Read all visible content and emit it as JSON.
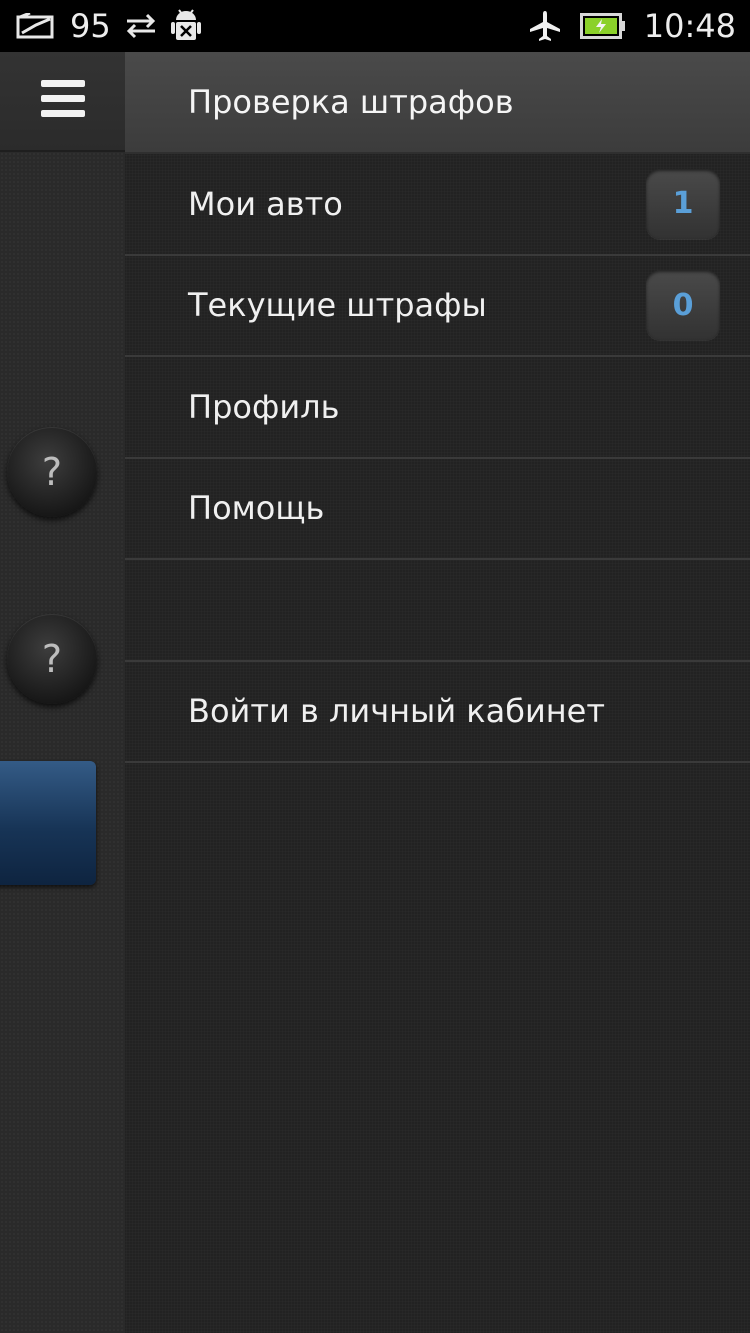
{
  "status_bar": {
    "signal_value": "95",
    "time": "10:48",
    "icons": [
      "mail-icon",
      "sync-icon",
      "android-debug-icon",
      "airplane-icon",
      "battery-charging-icon"
    ]
  },
  "left_pane": {
    "menu_icon": "hamburger-icon",
    "help_buttons": [
      "?",
      "?"
    ]
  },
  "drawer": {
    "title": "Проверка штрафов",
    "items": [
      {
        "label": "Мои авто",
        "badge": "1"
      },
      {
        "label": "Текущие штрафы",
        "badge": "0"
      },
      {
        "label": "Профиль"
      },
      {
        "label": "Помощь"
      },
      {
        "label": ""
      },
      {
        "label": "Войти в личный кабинет"
      }
    ]
  },
  "colors": {
    "badge_text": "#5a9fd8",
    "accent_blue": "#173456",
    "battery": "#8bd12a"
  }
}
